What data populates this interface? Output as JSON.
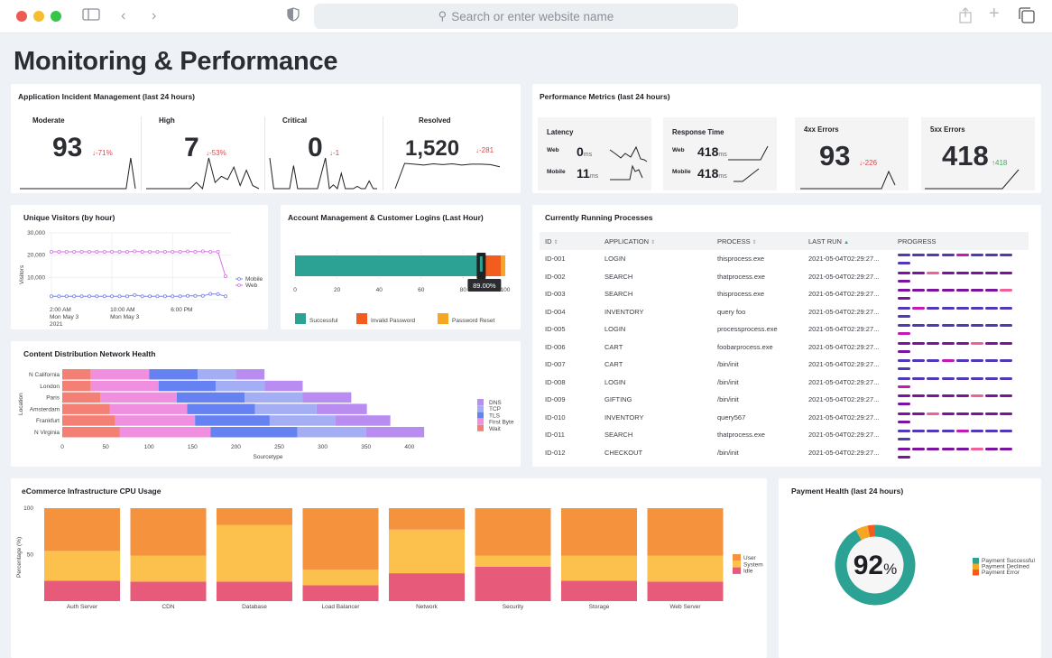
{
  "browser": {
    "search_placeholder": "Search or enter website name",
    "icons": [
      "sidebar-icon",
      "back-icon",
      "forward-icon",
      "shield-icon",
      "share-icon",
      "new-tab-icon",
      "tabs-icon"
    ]
  },
  "page": {
    "title": "Monitoring & Performance"
  },
  "incidents": {
    "title": "Application Incident Management (last 24 hours)",
    "items": [
      {
        "label": "Moderate",
        "value": "93",
        "delta": "-71%",
        "direction": "down",
        "spark": [
          0,
          0,
          0,
          0,
          0,
          0,
          0,
          0,
          0,
          0,
          0,
          0,
          0,
          0,
          0,
          0,
          0,
          0,
          0,
          0,
          0,
          0,
          0,
          0,
          5,
          0
        ]
      },
      {
        "label": "High",
        "value": "7",
        "delta": "-53%",
        "direction": "down",
        "spark": [
          0,
          0,
          0,
          0,
          0,
          0,
          0,
          0,
          1,
          0,
          5,
          1,
          2,
          1.5,
          3.5,
          0.5,
          3,
          0.5,
          0
        ]
      },
      {
        "label": "Critical",
        "value": "0",
        "delta": "-1",
        "direction": "down",
        "spark": [
          4,
          0,
          0,
          0,
          0,
          0,
          3,
          0,
          0,
          0,
          0,
          0,
          0,
          2,
          4,
          0,
          0.5,
          0,
          2,
          0,
          0,
          0,
          0.3,
          0,
          0,
          1,
          0,
          0
        ]
      },
      {
        "label": "Resolved",
        "value": "1,520",
        "delta": "-281",
        "direction": "down",
        "spark": [
          0,
          6,
          5.8,
          5.6,
          5.9,
          5.7,
          5.9,
          5.6,
          5.8,
          5.8,
          5.7,
          5.2
        ]
      }
    ]
  },
  "performance": {
    "title": "Performance Metrics (last 24 hours)",
    "latency": {
      "label": "Latency",
      "web_label": "Web",
      "web_value": "0",
      "mobile_label": "Mobile",
      "mobile_value": "11",
      "unit": "ms"
    },
    "response": {
      "label": "Response Time",
      "web_label": "Web",
      "web_value": "418",
      "mobile_label": "Mobile",
      "mobile_value": "418",
      "unit": "ms"
    },
    "errors_4xx": {
      "label": "4xx Errors",
      "value": "93",
      "delta": "-226",
      "direction": "down"
    },
    "errors_5xx": {
      "label": "5xx Errors",
      "value": "418",
      "delta": "418",
      "direction": "up"
    }
  },
  "visitors": {
    "title": "Unique Visitors (by hour)",
    "ylabel": "Visitors",
    "yticks": [
      "30,000",
      "20,000",
      "10,000"
    ],
    "xticks": [
      [
        "2:00 AM",
        "Mon May 3",
        "2021"
      ],
      [
        "10:00 AM",
        "Mon May 3"
      ],
      [
        "6:00 PM"
      ]
    ],
    "legend": [
      "Mobile",
      "Web"
    ]
  },
  "logins": {
    "title": "Account Management & Customer Logins (Last Hour)",
    "ticks": [
      "0",
      "20",
      "40",
      "60",
      "80",
      "100"
    ],
    "tooltip": "89.00%",
    "legend": [
      "Successful",
      "Invalid Password",
      "Password Reset"
    ]
  },
  "cdn": {
    "title": "Content Distribution Network Health",
    "ylabel": "Location",
    "xlabel": "Sourcetype",
    "xticks": [
      "0",
      "50",
      "100",
      "150",
      "200",
      "250",
      "300",
      "350",
      "400"
    ],
    "legend": [
      "DNS",
      "TCP",
      "TLS",
      "First Byte",
      "Wait"
    ]
  },
  "processes": {
    "title": "Currently Running Processes",
    "columns": [
      "ID",
      "APPLICATION",
      "PROCESS",
      "LAST RUN",
      "PROGRESS"
    ],
    "rows": [
      {
        "id": "ID-001",
        "app": "LOGIN",
        "process": "thisprocess.exe",
        "last_run": "2021-05-04T02:29:27...",
        "scheme": "blue",
        "highlight": 4
      },
      {
        "id": "ID-002",
        "app": "SEARCH",
        "process": "thatprocess.exe",
        "last_run": "2021-05-04T02:29:27...",
        "scheme": "purple",
        "highlight": 2
      },
      {
        "id": "ID-003",
        "app": "SEARCH",
        "process": "thisprocess.exe",
        "last_run": "2021-05-04T02:29:27...",
        "scheme": "purple",
        "highlight": 7
      },
      {
        "id": "ID-004",
        "app": "INVENTORY",
        "process": "query foo",
        "last_run": "2021-05-04T02:29:27...",
        "scheme": "blue",
        "highlight": 1
      },
      {
        "id": "ID-005",
        "app": "LOGIN",
        "process": "processprocess.exe",
        "last_run": "2021-05-04T02:29:27...",
        "scheme": "blue",
        "highlight": 8
      },
      {
        "id": "ID-006",
        "app": "CART",
        "process": "foobarprocess.exe",
        "last_run": "2021-05-04T02:29:27...",
        "scheme": "purple",
        "highlight": 5
      },
      {
        "id": "ID-007",
        "app": "CART",
        "process": "/bin/init",
        "last_run": "2021-05-04T02:29:27...",
        "scheme": "blue",
        "highlight": 3
      },
      {
        "id": "ID-008",
        "app": "LOGIN",
        "process": "/bin/init",
        "last_run": "2021-05-04T02:29:27...",
        "scheme": "blue",
        "highlight": 8
      },
      {
        "id": "ID-009",
        "app": "GIFTING",
        "process": "/bin/init",
        "last_run": "2021-05-04T02:29:27...",
        "scheme": "purple",
        "highlight": 5
      },
      {
        "id": "ID-010",
        "app": "INVENTORY",
        "process": "query567",
        "last_run": "2021-05-04T02:29:27...",
        "scheme": "purple",
        "highlight": 2
      },
      {
        "id": "ID-011",
        "app": "SEARCH",
        "process": "thatprocess.exe",
        "last_run": "2021-05-04T02:29:27...",
        "scheme": "blue",
        "highlight": 4
      },
      {
        "id": "ID-012",
        "app": "CHECKOUT",
        "process": "/bin/init",
        "last_run": "2021-05-04T02:29:27...",
        "scheme": "purple",
        "highlight": 5
      }
    ]
  },
  "cpu": {
    "title": "eCommerce Infrastructure CPU Usage",
    "ylabel": "Percentage (%)",
    "yticks": [
      "100",
      "50"
    ],
    "legend": [
      "User",
      "System",
      "Idle"
    ]
  },
  "payment": {
    "title": "Payment Health (last 24 hours)",
    "center_value": "92",
    "center_unit": "%",
    "legend": [
      "Payment Successful",
      "Payment Declined",
      "Payment Error"
    ]
  },
  "colors": {
    "teal": "#2ba293",
    "orange_red": "#f25c1e",
    "amber": "#f5a623",
    "mobile": "#7b86e8",
    "web": "#d872e6",
    "dns": "#b98cf2",
    "tcp": "#a4aef5",
    "tls": "#6581f2",
    "first_byte": "#f08ee0",
    "wait": "#f47f74",
    "cpu_user": "#f5923e",
    "cpu_system": "#fcc04d",
    "cpu_idle": "#e85a7a",
    "prog_blue": "#5138b9",
    "prog_purple": "#7e12a0",
    "prog_pink_blue": "#c41ab5",
    "prog_pink_purple": "#f0609a"
  },
  "chart_data": [
    {
      "type": "line",
      "title": "Unique Visitors (by hour)",
      "ylabel": "Visitors",
      "ylim": [
        0,
        30000
      ],
      "x": [
        "2:00 AM",
        "3:00 AM",
        "4:00 AM",
        "5:00 AM",
        "6:00 AM",
        "7:00 AM",
        "8:00 AM",
        "9:00 AM",
        "10:00 AM",
        "11:00 AM",
        "12:00 PM",
        "1:00 PM",
        "2:00 PM",
        "3:00 PM",
        "4:00 PM",
        "5:00 PM",
        "6:00 PM",
        "7:00 PM",
        "8:00 PM",
        "9:00 PM",
        "10:00 PM",
        "11:00 PM",
        "12:00 AM",
        "1:00 AM",
        "2:00 AM",
        "3:00 AM"
      ],
      "series": [
        {
          "name": "Mobile",
          "values": [
            1500,
            1500,
            1500,
            1500,
            1500,
            1500,
            1500,
            1500,
            1500,
            1500,
            1500,
            2100,
            1500,
            1500,
            1500,
            1500,
            1500,
            1500,
            1700,
            1700,
            1700,
            2600,
            2500,
            1500,
            1500
          ]
        },
        {
          "name": "Web",
          "values": [
            21500,
            21500,
            21500,
            21500,
            21500,
            21500,
            21500,
            21500,
            21500,
            21500,
            21500,
            21700,
            21500,
            21500,
            21500,
            21500,
            21500,
            21500,
            21700,
            21500,
            21700,
            21500,
            21500,
            10500
          ]
        }
      ],
      "legend": "right"
    },
    {
      "type": "bar",
      "title": "Account Management & Customer Logins (Last Hour)",
      "orientation": "horizontal-stacked",
      "xlim": [
        0,
        100
      ],
      "series": [
        {
          "name": "Successful",
          "values": [
            89
          ]
        },
        {
          "name": "Invalid Password",
          "values": [
            9
          ]
        },
        {
          "name": "Password Reset",
          "values": [
            2
          ]
        }
      ],
      "annotation": "89.00%",
      "legend": "bottom"
    },
    {
      "type": "bar",
      "title": "Content Distribution Network Health",
      "orientation": "horizontal-stacked",
      "xlabel": "Sourcetype",
      "ylabel": "Location",
      "xlim": [
        0,
        420
      ],
      "categories": [
        "N California",
        "London",
        "Paris",
        "Amsterdam",
        "Frankfurt",
        "N Virginia"
      ],
      "series": [
        {
          "name": "Wait",
          "values": [
            33,
            33,
            44,
            55,
            61,
            66
          ]
        },
        {
          "name": "First Byte",
          "values": [
            67,
            78,
            88,
            89,
            92,
            105
          ]
        },
        {
          "name": "TLS",
          "values": [
            56,
            66,
            78,
            78,
            86,
            100
          ]
        },
        {
          "name": "TCP",
          "values": [
            44,
            56,
            67,
            71,
            76,
            79
          ]
        },
        {
          "name": "DNS",
          "values": [
            33,
            44,
            56,
            58,
            63,
            67
          ]
        }
      ],
      "legend": "right"
    },
    {
      "type": "bar",
      "title": "eCommerce Infrastructure CPU Usage",
      "orientation": "vertical-stacked",
      "ylabel": "Percentage (%)",
      "ylim": [
        0,
        100
      ],
      "categories": [
        "Auth Server",
        "CDN",
        "Database",
        "Load Balancer",
        "Network",
        "Security",
        "Storage",
        "Web Server"
      ],
      "series": [
        {
          "name": "Idle",
          "values": [
            22,
            21,
            21,
            17,
            30,
            37,
            22,
            21
          ]
        },
        {
          "name": "System",
          "values": [
            32,
            28,
            61,
            17,
            47,
            12,
            27,
            28
          ]
        },
        {
          "name": "User",
          "values": [
            46,
            51,
            18,
            66,
            23,
            51,
            51,
            51
          ]
        }
      ],
      "legend": "right"
    },
    {
      "type": "pie",
      "title": "Payment Health (last 24 hours)",
      "donut": true,
      "categories": [
        "Payment Successful",
        "Payment Declined",
        "Payment Error"
      ],
      "values": [
        92,
        5,
        3
      ],
      "center_label": "92%",
      "legend": "right"
    }
  ]
}
